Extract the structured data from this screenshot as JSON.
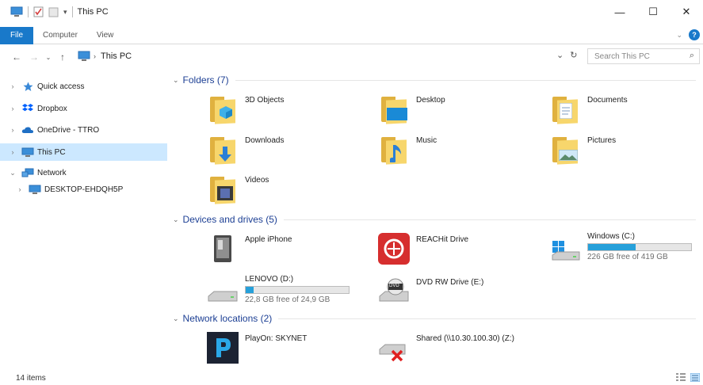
{
  "window": {
    "title": "This PC",
    "minimize": "—",
    "maximize": "☐",
    "close": "✕"
  },
  "ribbon": {
    "tabs": [
      "File",
      "Computer",
      "View"
    ],
    "help": "?"
  },
  "address": {
    "crumb": "This PC",
    "search_placeholder": "Search This PC"
  },
  "sidebar": {
    "items": [
      {
        "label": "Quick access",
        "icon": "star-icon"
      },
      {
        "label": "Dropbox",
        "icon": "dropbox-icon"
      },
      {
        "label": "OneDrive - TTRO",
        "icon": "onedrive-cloud-icon"
      },
      {
        "label": "This PC",
        "icon": "computer-icon",
        "selected": true
      },
      {
        "label": "Network",
        "icon": "network-icon"
      },
      {
        "label": "DESKTOP-EHDQH5P",
        "icon": "computer-icon"
      }
    ]
  },
  "groups": {
    "folders": {
      "title": "Folders (7)",
      "items": [
        "3D Objects",
        "Desktop",
        "Documents",
        "Downloads",
        "Music",
        "Pictures",
        "Videos"
      ]
    },
    "devices": {
      "title": "Devices and drives (5)",
      "items": [
        {
          "name": "Apple iPhone"
        },
        {
          "name": "REACHit Drive"
        },
        {
          "name": "Windows (C:)",
          "free": "226 GB free of 419 GB",
          "used_fraction": 0.46
        },
        {
          "name": "LENOVO (D:)",
          "free": "22,8 GB free of 24,9 GB",
          "used_fraction": 0.08
        },
        {
          "name": "DVD RW Drive (E:)",
          "badge": "DVD"
        }
      ]
    },
    "network": {
      "title": "Network locations (2)",
      "items": [
        "PlayOn: SKYNET",
        "Shared (\\\\10.30.100.30) (Z:)"
      ]
    }
  },
  "status": {
    "count": "14 items"
  },
  "colors": {
    "accent": "#1979ca",
    "selection": "#cce8ff",
    "drive_fill": "#26a0da",
    "group_header": "#1c3f94"
  }
}
